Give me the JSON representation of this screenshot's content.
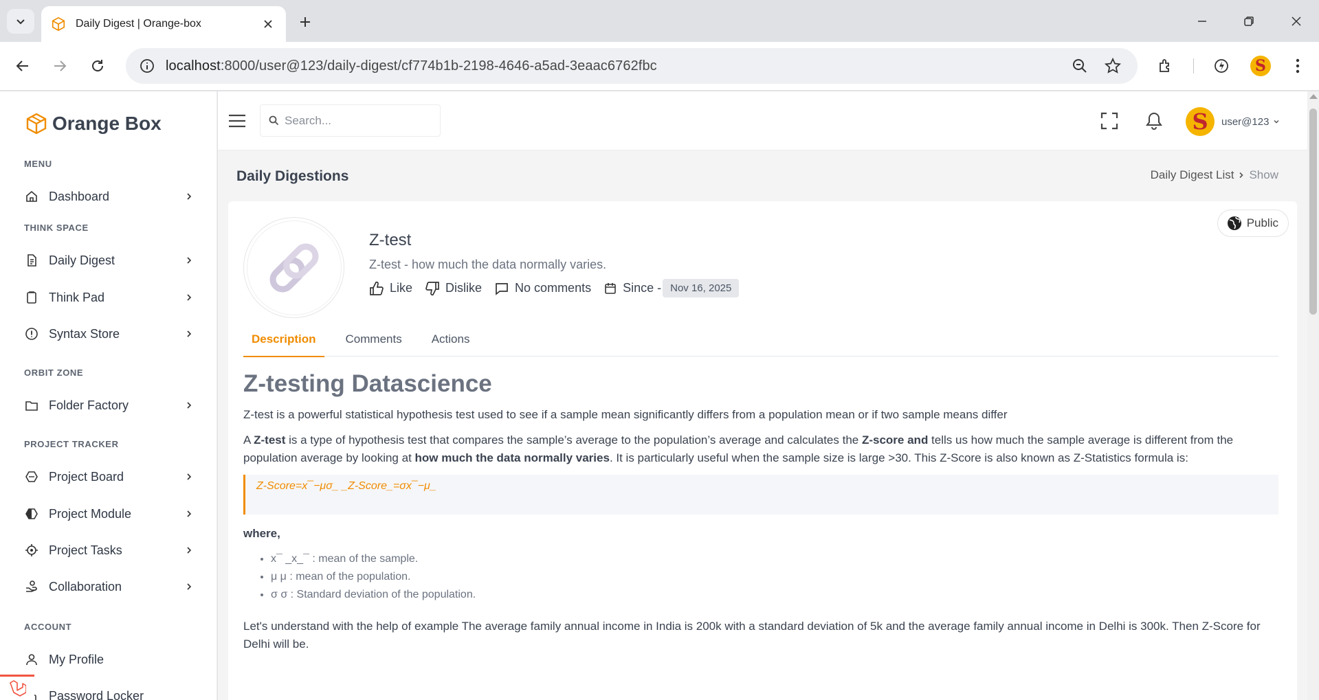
{
  "browser": {
    "tab_title": "Daily Digest | Orange-box",
    "url_host": "localhost",
    "url_path": ":8000/user@123/daily-digest/cf774b1b-2198-4646-a5ad-3eaac6762fbc",
    "profile_initial": "S"
  },
  "sidebar": {
    "brand": "Orange Box",
    "sections": {
      "menu": "MENU",
      "think_space": "THINK SPACE",
      "orbit_zone": "ORBIT ZONE",
      "project_tracker": "PROJECT TRACKER",
      "account": "ACCOUNT"
    },
    "items": {
      "dashboard": "Dashboard",
      "daily_digest": "Daily Digest",
      "think_pad": "Think Pad",
      "syntax_store": "Syntax Store",
      "folder_factory": "Folder Factory",
      "project_board": "Project Board",
      "project_module": "Project Module",
      "project_tasks": "Project Tasks",
      "collaboration": "Collaboration",
      "my_profile": "My Profile",
      "password_locker": "Password Locker"
    }
  },
  "header": {
    "search_placeholder": "Search...",
    "user_initial": "S",
    "user_name": "user@123"
  },
  "page": {
    "title": "Daily Digestions",
    "breadcrumb_parent": "Daily Digest List",
    "breadcrumb_current": "Show"
  },
  "digest": {
    "visibility": "Public",
    "title": "Z-test",
    "subtitle": "Z-test - how much the data normally varies.",
    "like_label": "Like",
    "dislike_label": "Dislike",
    "comments_label": "No comments",
    "since_label": "Since -",
    "date": "Nov 16, 2025",
    "tabs": [
      "Description",
      "Comments",
      "Actions"
    ],
    "active_tab": "Description"
  },
  "article": {
    "heading": "Z-testing Datascience",
    "intro": "Z-test is a powerful statistical hypothesis test used to see if a sample mean significantly differs from a population mean or if two sample means differ",
    "p2_a": "A ",
    "p2_b": "Z-test",
    "p2_c": " is a type of hypothesis test that compares the sample’s average to the population’s average and calculates the ",
    "p2_d": "Z-score and",
    "p2_e": " tells us how much the sample average is different from the population average by looking at ",
    "p2_f": "how much the data normally varies",
    "p2_g": ". It is particularly useful when the sample size is large >30. This Z-Score is also known as Z-Statistics formula is:",
    "formula": "Z-Score=x¯−μσ_ _Z-Score_=σx¯−μ_",
    "where": "where,",
    "bullets": [
      "x¯ _x_¯ : mean of the sample.",
      "μ μ : mean of the population.",
      "σ σ : Standard deviation of the population."
    ],
    "example": "Let's understand with the help of example The average family annual income in India is 200k with a standard deviation of 5k and the average family annual income in Delhi is 300k. Then Z-Score for Delhi will be."
  },
  "colors": {
    "accent": "#f08c00",
    "brand_text": "#3b4350"
  }
}
